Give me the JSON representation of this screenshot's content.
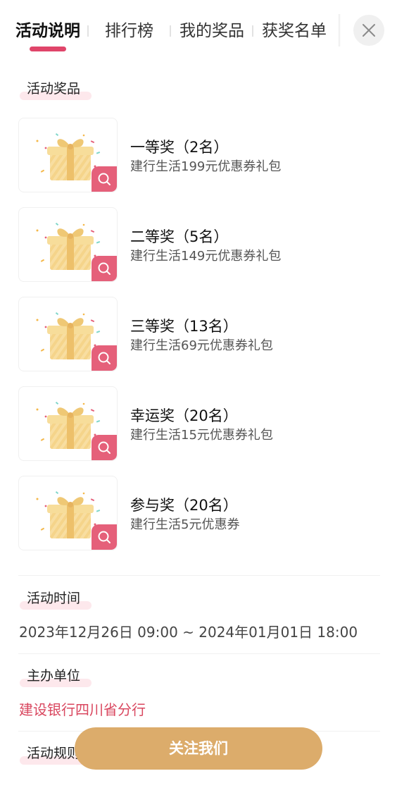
{
  "tabs": [
    {
      "label": "活动说明",
      "active": true
    },
    {
      "label": "排行榜",
      "active": false
    },
    {
      "label": "我的奖品",
      "active": false
    },
    {
      "label": "获奖名单",
      "active": false
    }
  ],
  "close_icon": "close-icon",
  "prizes_section": {
    "label": "活动奖品",
    "items": [
      {
        "title": "一等奖（2名）",
        "desc": "建行生活199元优惠券礼包",
        "icon": "gift-icon"
      },
      {
        "title": "二等奖（5名）",
        "desc": "建行生活149元优惠券礼包",
        "icon": "gift-icon"
      },
      {
        "title": "三等奖（13名）",
        "desc": "建行生活69元优惠券礼包",
        "icon": "gift-icon"
      },
      {
        "title": "幸运奖（20名）",
        "desc": "建行生活15元优惠券礼包",
        "icon": "gift-icon"
      },
      {
        "title": "参与奖（20名）",
        "desc": "建行生活5元优惠券",
        "icon": "gift-icon"
      }
    ]
  },
  "time_section": {
    "label": "活动时间",
    "value": "2023年12月26日 09:00 ~ 2024年01月01日 18:00"
  },
  "organizer_section": {
    "label": "主办单位",
    "value": "建设银行四川省分行"
  },
  "rules_section": {
    "label": "活动规则"
  },
  "follow_button": {
    "label": "关注我们"
  },
  "colors": {
    "accent": "#e0456a",
    "zoom_badge": "#e5607a",
    "organizer_text": "#d9475f",
    "follow_button": "#dcac6b",
    "label_highlight": "#fde8ec"
  }
}
